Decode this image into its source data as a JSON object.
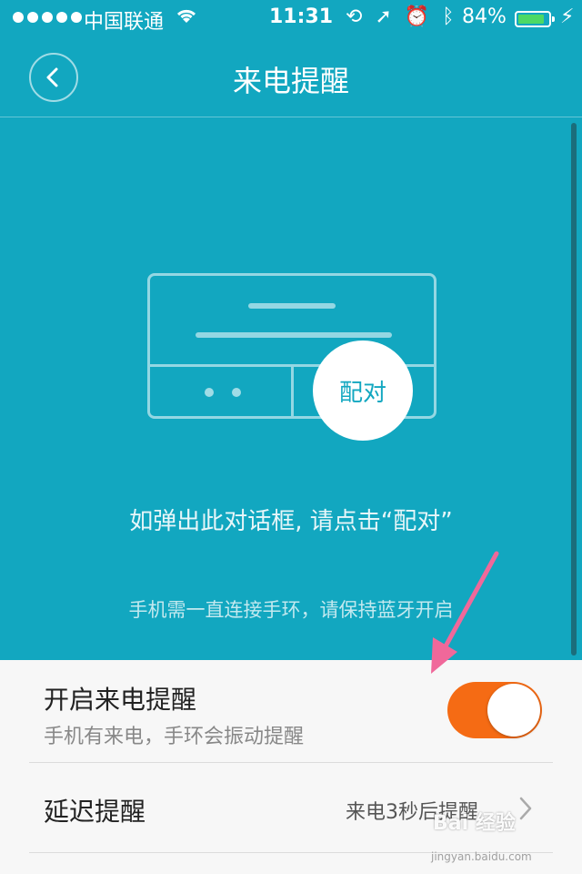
{
  "status_bar": {
    "carrier": "中国联通",
    "time": "11:31",
    "battery_percent": "84%",
    "battery_level": 0.84,
    "accent_battery": "#4cd964"
  },
  "header": {
    "title": "来电提醒",
    "back_icon": "chevron-left-icon"
  },
  "illustration": {
    "pair_button_label": "配对"
  },
  "hints": {
    "dialog_hint": "如弹出此对话框, 请点击“配对”",
    "bluetooth_hint": "手机需一直连接手环，请保持蓝牙开启"
  },
  "settings": {
    "call_alert": {
      "label": "开启来电提醒",
      "subtitle": "手机有来电，手环会振动提醒",
      "enabled": true
    },
    "delay_alert": {
      "label": "延迟提醒",
      "value": "来电3秒后提醒"
    }
  },
  "watermark": {
    "text": "Bai 经验",
    "url_text": "jingyan.baidu.com"
  },
  "colors": {
    "header_bg": "#12a7c0",
    "toggle_on": "#f56b14",
    "arrow": "#f0689a"
  }
}
